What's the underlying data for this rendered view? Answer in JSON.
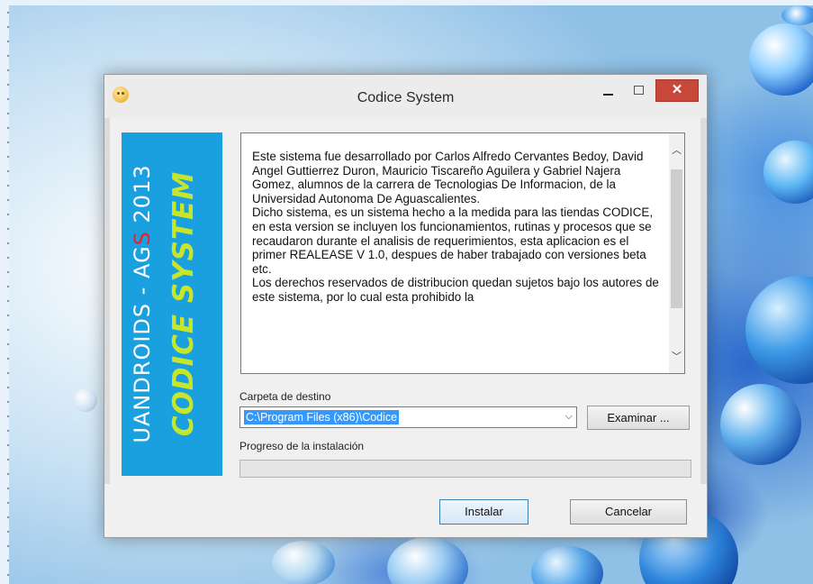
{
  "window": {
    "title": "Codice System",
    "controls": {
      "minimize": "minimize",
      "maximize": "maximize",
      "close": "✕"
    }
  },
  "banner": {
    "line1_pre": "UANDROIDS - AG",
    "line1_red": "S",
    "line1_post": " 2013",
    "line2": "CODICE SYSTEM"
  },
  "description": "Este sistema fue desarrollado por Carlos Alfredo Cervantes Bedoy, David Angel Guttierrez Duron, Mauricio Tiscareño Aguilera y Gabriel Najera Gomez, alumnos de la carrera de Tecnologias De Informacion, de la Universidad Autonoma De Aguascalientes.\nDicho sistema, es un sistema hecho a la medida para las tiendas CODICE, en esta version se incluyen los funcionamientos, rutinas y procesos que se recaudaron durante el analisis de requerimientos, esta aplicacion es el primer REALEASE V 1.0, despues de haber trabajado con versiones beta etc.\nLos derechos reservados de distribucion quedan sujetos bajo los autores de este sistema, por lo cual esta prohibido la",
  "destination": {
    "label": "Carpeta de destino",
    "value": "C:\\Program Files (x86)\\Codice",
    "browse_label": "Examinar ..."
  },
  "progress": {
    "label": "Progreso de la instalación",
    "percent": 0
  },
  "buttons": {
    "install": "Instalar",
    "cancel": "Cancelar"
  },
  "icons": {
    "app": "smiley-icon",
    "scroll_up": "chevron-up-icon",
    "scroll_down": "chevron-down-icon",
    "dropdown": "chevron-down-icon"
  }
}
